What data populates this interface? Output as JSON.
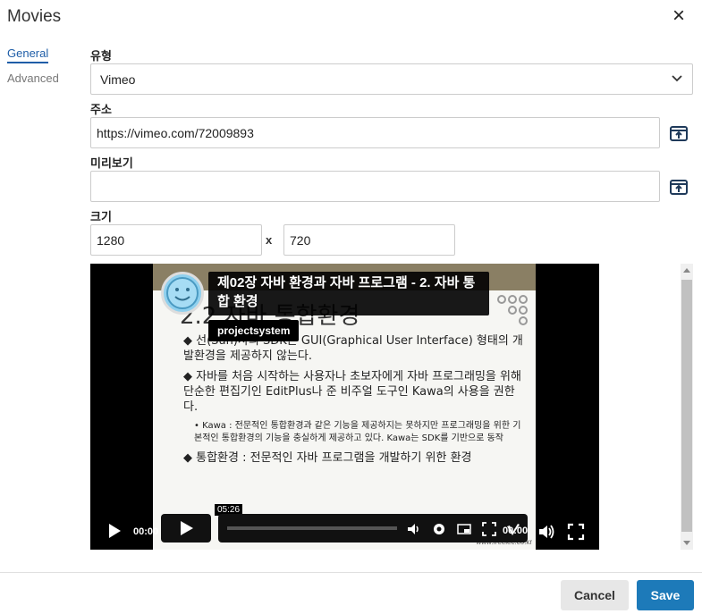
{
  "dialog": {
    "title": "Movies",
    "close_icon": "×"
  },
  "tabs": [
    {
      "label": "General",
      "active": true
    },
    {
      "label": "Advanced",
      "active": false
    }
  ],
  "form": {
    "type_label": "유형",
    "type_value": "Vimeo",
    "url_label": "주소",
    "url_value": "https://vimeo.com/72009893",
    "preview_label": "미리보기",
    "preview_value": "",
    "size_label": "크기",
    "width_value": "1280",
    "size_separator": "x",
    "height_value": "720"
  },
  "player": {
    "video_title": "제02장 자바 환경과 자바 프로그램 - 2. 자바 통합 환경",
    "channel": "projectsystem",
    "hover_time": "05:26",
    "vimeo_time": "00:00",
    "outer_time": "00:00",
    "slide_heading": "2.2 자바 통합환경",
    "slide_lines": [
      "◆ 선(Sun)사의 SDK는 GUI(Graphical User Interface) 형태의 개발환경을 제공하지 않는다.",
      "◆ 자바를 처음 시작하는 사용자나 초보자에게 자바 프로그래밍을 위해 단순한 편집기인 EditPlus나 준 비주얼 도구인 Kawa의 사용을 권한다.",
      "• Kawa : 전문적인 통합환경과 같은 기능을 제공하지는 못하지만 프로그래밍을 위한 기본적인 통합환경의 기능을 충실하게 제공하고 있다. Kawa는 SDK를 기반으로 동작",
      "◆ 통합환경 : 전문적인 자바 프로그램을 개발하기 위한 환경"
    ],
    "slide_footer": "www.freelec.co.kr"
  },
  "footer": {
    "cancel_label": "Cancel",
    "save_label": "Save"
  },
  "colors": {
    "accent": "#1d7ab9",
    "tab_active": "#1f5ea8"
  }
}
